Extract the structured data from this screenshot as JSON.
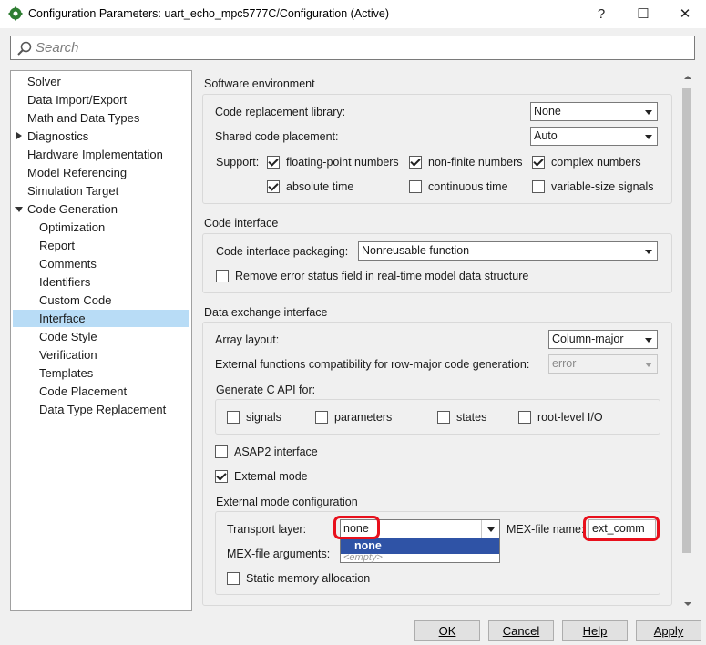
{
  "window": {
    "title": "Configuration Parameters: uart_echo_mpc5777C/Configuration (Active)",
    "help_glyph": "?",
    "maximize_glyph": "☐",
    "close_glyph": "✕"
  },
  "search": {
    "placeholder": "Search",
    "value": ""
  },
  "tree": {
    "items": [
      {
        "label": "Solver"
      },
      {
        "label": "Data Import/Export"
      },
      {
        "label": "Math and Data Types"
      },
      {
        "label": "Diagnostics",
        "expander": "collapsed"
      },
      {
        "label": "Hardware Implementation"
      },
      {
        "label": "Model Referencing"
      },
      {
        "label": "Simulation Target"
      },
      {
        "label": "Code Generation",
        "expander": "expanded"
      },
      {
        "label": "Optimization"
      },
      {
        "label": "Report"
      },
      {
        "label": "Comments"
      },
      {
        "label": "Identifiers"
      },
      {
        "label": "Custom Code"
      },
      {
        "label": "Interface",
        "selected": true
      },
      {
        "label": "Code Style"
      },
      {
        "label": "Verification"
      },
      {
        "label": "Templates"
      },
      {
        "label": "Code Placement"
      },
      {
        "label": "Data Type Replacement"
      }
    ]
  },
  "software_env": {
    "title": "Software environment",
    "crl_label": "Code replacement library:",
    "crl_value": "None",
    "scp_label": "Shared code placement:",
    "scp_value": "Auto",
    "support_label": "Support:",
    "support": {
      "floating_point": {
        "label": "floating-point numbers",
        "checked": true
      },
      "non_finite": {
        "label": "non-finite numbers",
        "checked": true
      },
      "complex": {
        "label": "complex numbers",
        "checked": true
      },
      "absolute_time": {
        "label": "absolute time",
        "checked": true
      },
      "continuous_time": {
        "label": "continuous time",
        "checked": false
      },
      "variable_size": {
        "label": "variable-size signals",
        "checked": false
      }
    }
  },
  "code_interface": {
    "title": "Code interface",
    "packaging_label": "Code interface packaging:",
    "packaging_value": "Nonreusable function",
    "remove_error_label": "Remove error status field in real-time model data structure",
    "remove_error_checked": false
  },
  "data_exchange": {
    "title": "Data exchange interface",
    "array_layout_label": "Array layout:",
    "array_layout_value": "Column-major",
    "ext_fn_label": "External functions compatibility for row-major code generation:",
    "ext_fn_value": "error",
    "c_api_label": "Generate C API for:",
    "c_api": {
      "signals": {
        "label": "signals",
        "checked": false
      },
      "parameters": {
        "label": "parameters",
        "checked": false
      },
      "states": {
        "label": "states",
        "checked": false
      },
      "root_io": {
        "label": "root-level I/O",
        "checked": false
      }
    },
    "asap2_label": "ASAP2 interface",
    "asap2_checked": false,
    "external_mode_label": "External mode",
    "external_mode_checked": true,
    "ext_config_title": "External mode configuration",
    "transport_label": "Transport layer:",
    "transport_value": "none",
    "mex_name_label": "MEX-file name:",
    "mex_name_value": "ext_comm",
    "mex_args_label": "MEX-file arguments:",
    "mex_args_placeholder": "<empty>",
    "static_mem_label": "Static memory allocation",
    "static_mem_checked": false,
    "dropdown_options": [
      "none"
    ]
  },
  "buttons": {
    "ok": "OK",
    "cancel": "Cancel",
    "help": "Help",
    "apply": "Apply"
  },
  "annotation_color": "#e8101c",
  "selection_color": "#b8dcf6"
}
